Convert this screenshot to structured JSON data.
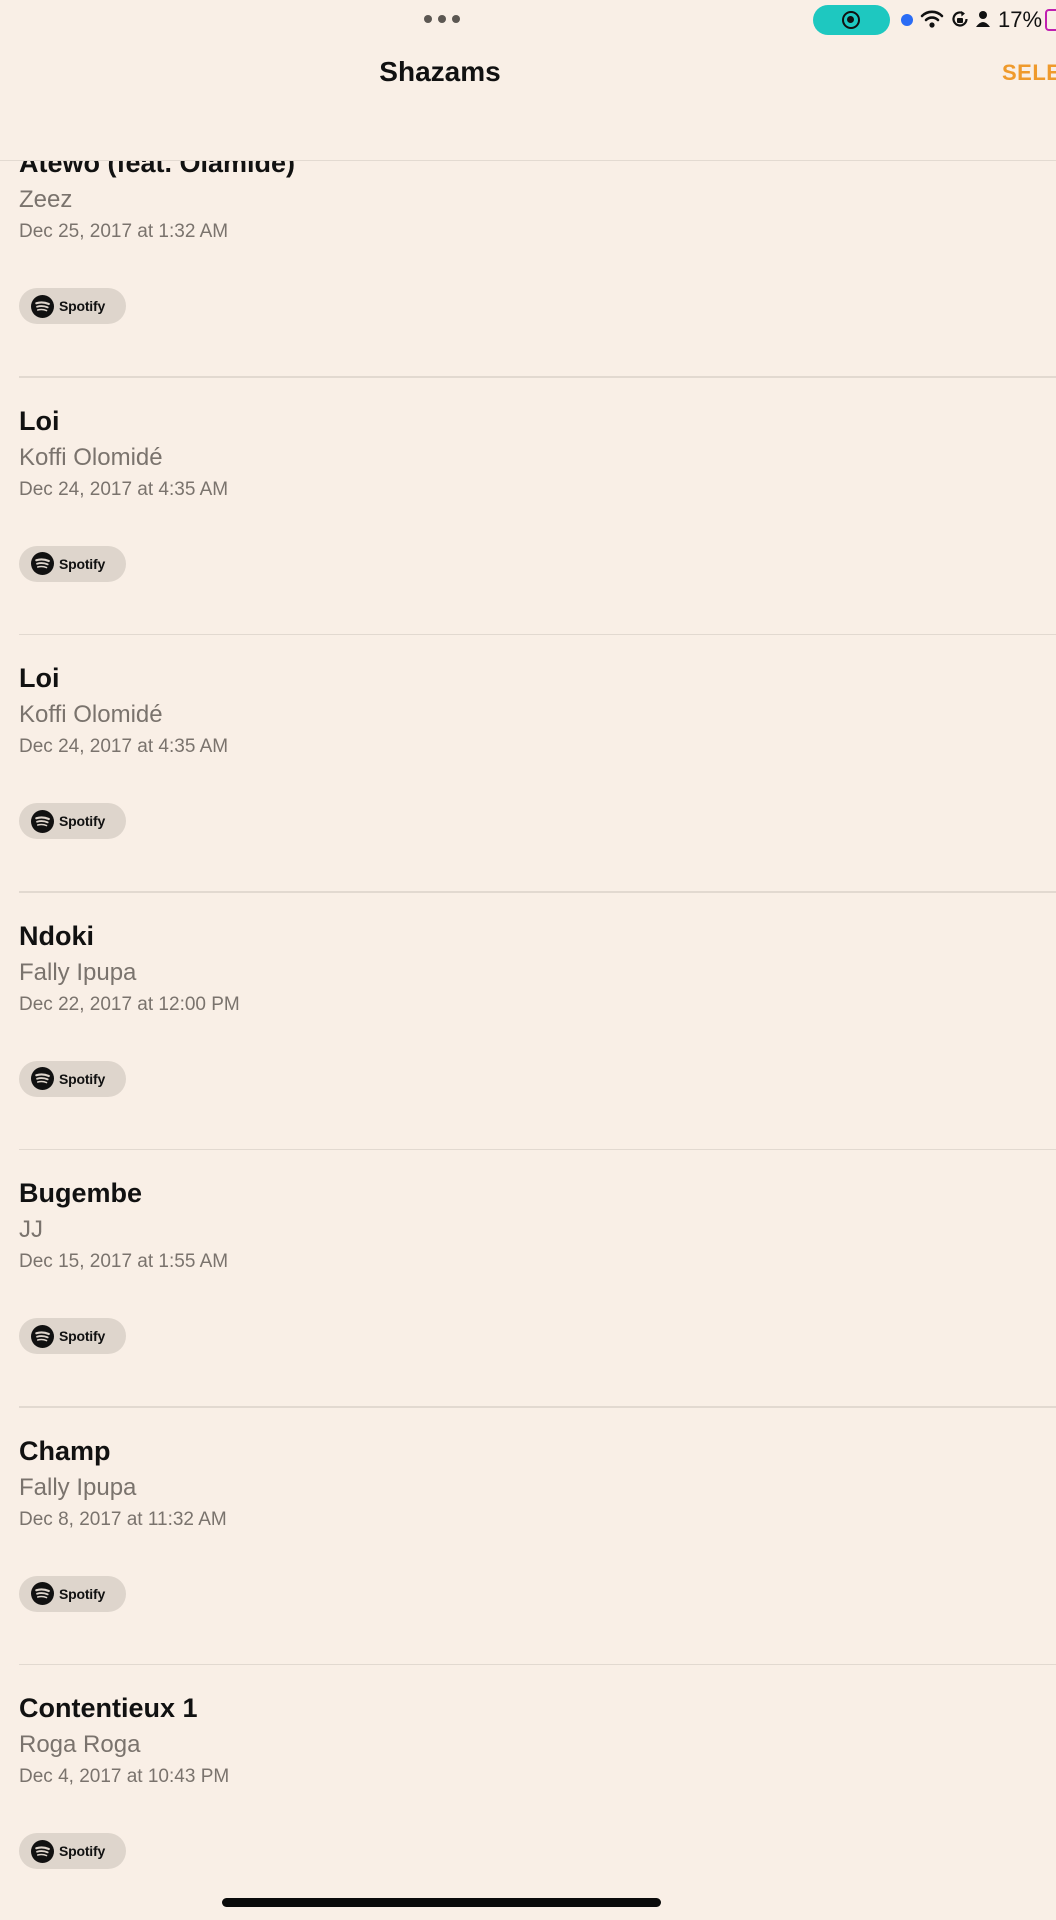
{
  "status_bar": {
    "battery_percent": "17%",
    "record_color": "#1ec8c0",
    "icons": [
      "more-dots-icon",
      "screen-record-icon",
      "location-dot-icon",
      "wifi-icon",
      "rotation-lock-icon",
      "person-icon",
      "battery-icon"
    ]
  },
  "nav": {
    "title": "Shazams",
    "select_label": "SELECT",
    "accent_color": "#ef9a2c"
  },
  "items": [
    {
      "title": "Atewo (feat. Olamide)",
      "artist": "Zeez",
      "date": "Dec 25, 2017 at 1:32 AM",
      "service": "Spotify"
    },
    {
      "title": "Loi",
      "artist": "Koffi Olomidé",
      "date": "Dec 24, 2017 at 4:35 AM",
      "service": "Spotify"
    },
    {
      "title": "Loi",
      "artist": "Koffi Olomidé",
      "date": "Dec 24, 2017 at 4:35 AM",
      "service": "Spotify"
    },
    {
      "title": "Ndoki",
      "artist": "Fally Ipupa",
      "date": "Dec 22, 2017 at 12:00 PM",
      "service": "Spotify"
    },
    {
      "title": "Bugembe",
      "artist": "JJ",
      "date": "Dec 15, 2017 at 1:55 AM",
      "service": "Spotify"
    },
    {
      "title": "Champ",
      "artist": "Fally Ipupa",
      "date": "Dec 8, 2017 at 11:32 AM",
      "service": "Spotify"
    },
    {
      "title": "Contentieux 1",
      "artist": "Roga Roga",
      "date": "Dec 4, 2017 at 10:43 PM",
      "service": "Spotify"
    }
  ]
}
